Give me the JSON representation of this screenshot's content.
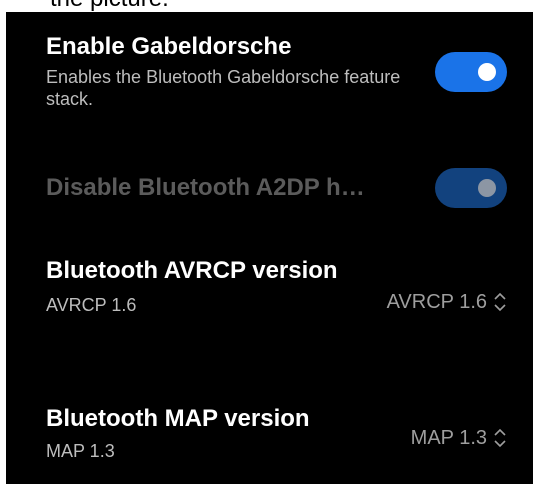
{
  "top_strip": {
    "text": "the picture."
  },
  "settings": {
    "gabeldorsche": {
      "title": "Enable Gabeldorsche",
      "subtitle": "Enables the Bluetooth Gabeldorsche feature stack.",
      "enabled": true
    },
    "a2dp": {
      "title": "Disable Bluetooth A2DP h…",
      "enabled": true,
      "disabled": true
    },
    "avrcp": {
      "title": "Bluetooth AVRCP version",
      "subtitle": "AVRCP 1.6",
      "selected_value": "AVRCP 1.6"
    },
    "map": {
      "title": "Bluetooth MAP version",
      "subtitle": "MAP 1.3",
      "selected_value": "MAP 1.3"
    }
  },
  "colors": {
    "background": "#000000",
    "accent": "#1a73e8",
    "accent_disabled": "#12427e",
    "text_primary": "#ffffff",
    "text_secondary": "#bdbdbd",
    "text_disabled": "#5b5b5b"
  },
  "icons": {
    "selector": "unfold-more-icon",
    "toggle": "switch-icon"
  }
}
